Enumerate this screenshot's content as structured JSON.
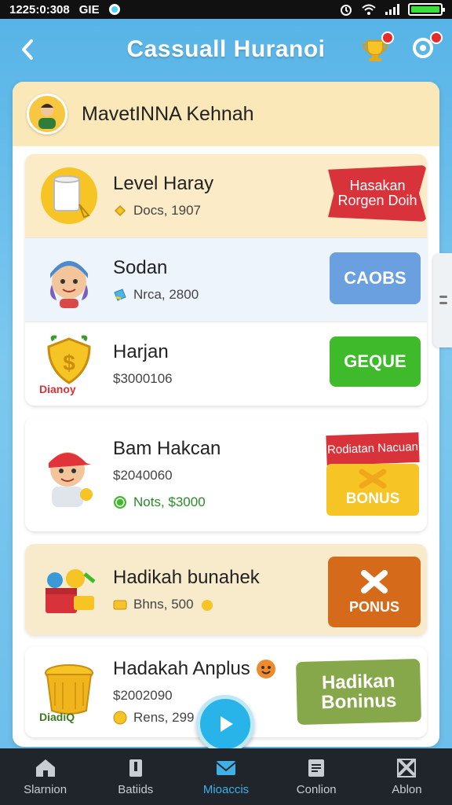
{
  "status_bar": {
    "time": "1225:0:308",
    "carrier": "GIE"
  },
  "header": {
    "title": "Cassuall Huranoi"
  },
  "profile": {
    "name": "MavetINNA Kehnah"
  },
  "rows": [
    {
      "title": "Level Haray",
      "subtitle": "Docs, 1907",
      "action": "Hasakan Rorgen Doih"
    },
    {
      "title": "Sodan",
      "subtitle": "Nrca, 2800",
      "action": "CAOBS"
    },
    {
      "title": "Harjan",
      "subtitle": "$3000106",
      "icon_caption": "Dianoy",
      "action": "GEQUE"
    },
    {
      "title": "Bam Hakcan",
      "subtitle": "$2040060",
      "subtitle2": "Nots, $3000",
      "tag": "Rodiatan Nacuan",
      "action": "BONUS"
    },
    {
      "title": "Hadikah bunahek",
      "subtitle": "Bhns, 500",
      "action": "PONUS"
    },
    {
      "title": "Hadakah Anplus",
      "subtitle": "$2002090",
      "subtitle2": "Rens, 299",
      "icon_caption": "DiadiQ",
      "action": "Hadikan Boninus"
    }
  ],
  "nav": [
    {
      "label": "Slarnion"
    },
    {
      "label": "Batiids"
    },
    {
      "label": "Mioaccis"
    },
    {
      "label": "Conlion"
    },
    {
      "label": "Ablon"
    }
  ],
  "colors": {
    "background": "#56b3e6",
    "accent": "#28b3e9",
    "red": "#d8333a",
    "green": "#3fba2a",
    "blue_button": "#6a9fe0",
    "orange": "#d46a1a",
    "yellow": "#f6c425",
    "olive": "#86a84a"
  }
}
